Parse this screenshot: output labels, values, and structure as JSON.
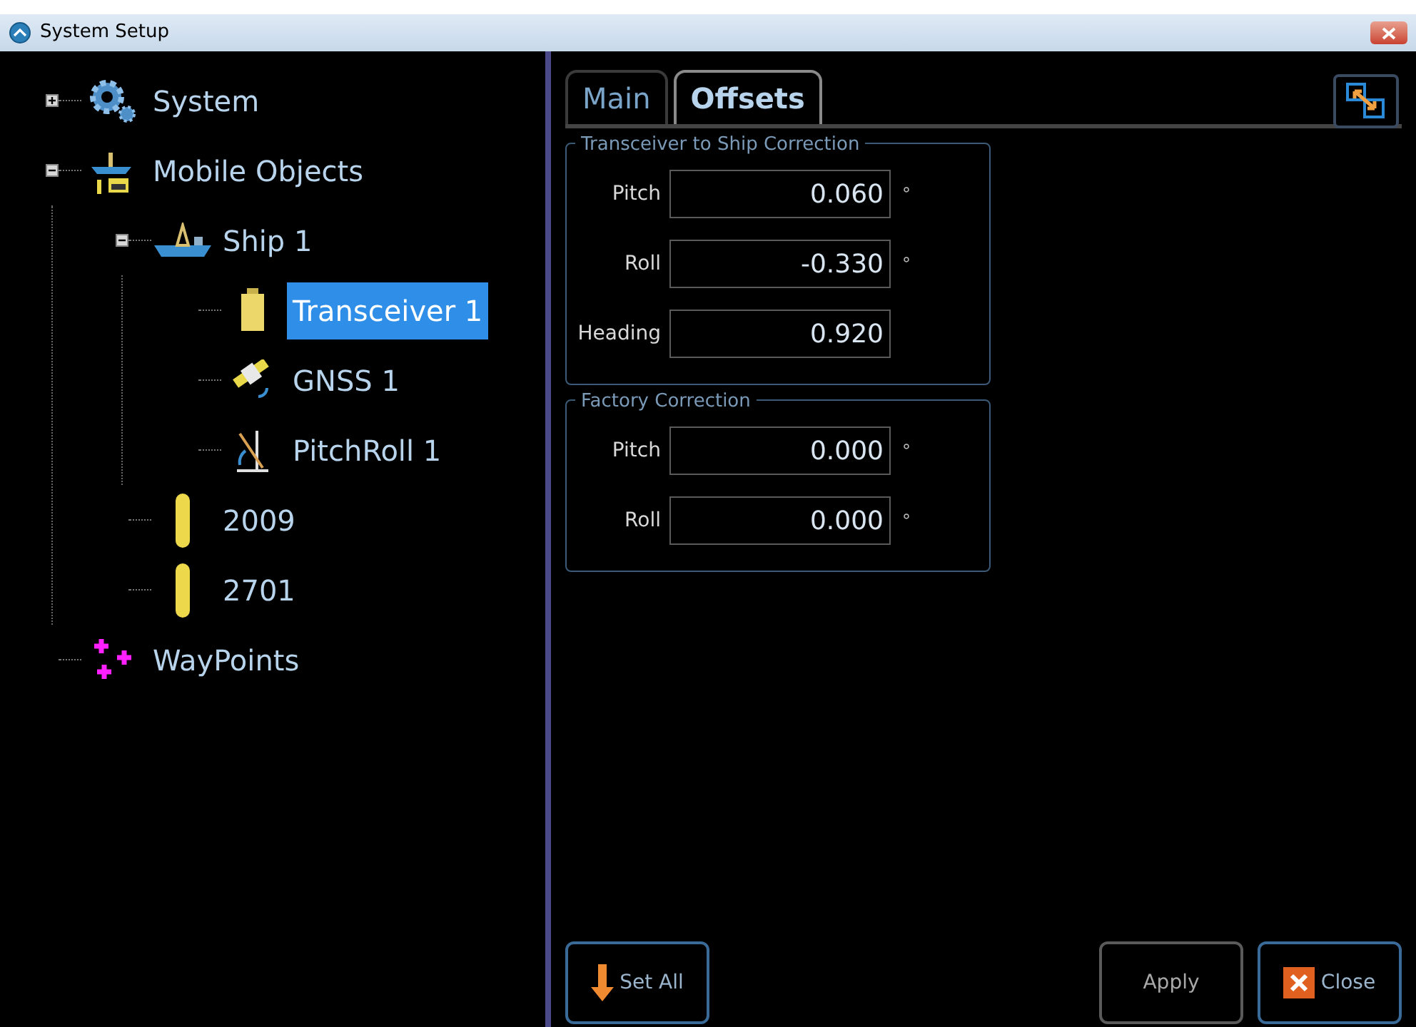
{
  "window": {
    "title": "System Setup"
  },
  "tree": [
    {
      "label": "System",
      "kind": "gear",
      "expanded": false,
      "selected": false
    },
    {
      "label": "Mobile Objects",
      "kind": "group",
      "expanded": true,
      "selected": false,
      "children": [
        {
          "label": "Ship 1",
          "kind": "ship",
          "expanded": true,
          "selected": false,
          "children": [
            {
              "label": "Transceiver 1",
              "kind": "transceiver",
              "selected": true
            },
            {
              "label": "GNSS 1",
              "kind": "gnss",
              "selected": false
            },
            {
              "label": "PitchRoll 1",
              "kind": "pitchroll",
              "selected": false
            }
          ]
        },
        {
          "label": "2009",
          "kind": "beacon",
          "selected": false
        },
        {
          "label": "2701",
          "kind": "beacon",
          "selected": false
        }
      ]
    },
    {
      "label": "WayPoints",
      "kind": "waypoints",
      "selected": false
    }
  ],
  "tabs": [
    {
      "label": "Main",
      "selected": false
    },
    {
      "label": "Offsets",
      "selected": true
    }
  ],
  "groups": [
    {
      "title": "Transceiver to Ship Correction",
      "fields": [
        {
          "label": "Pitch",
          "value": "0.060",
          "unit": "°"
        },
        {
          "label": "Roll",
          "value": "-0.330",
          "unit": "°"
        },
        {
          "label": "Heading",
          "value": "0.920"
        }
      ]
    },
    {
      "title": "Factory Correction",
      "fields": [
        {
          "label": "Pitch",
          "value": "0.000",
          "unit": "°"
        },
        {
          "label": "Roll",
          "value": "0.000",
          "unit": "°"
        }
      ]
    }
  ],
  "buttons": [
    {
      "label": "Set All",
      "kind": "setall"
    },
    {
      "label": "Apply",
      "kind": "apply"
    },
    {
      "label": "Close",
      "kind": "close"
    }
  ]
}
